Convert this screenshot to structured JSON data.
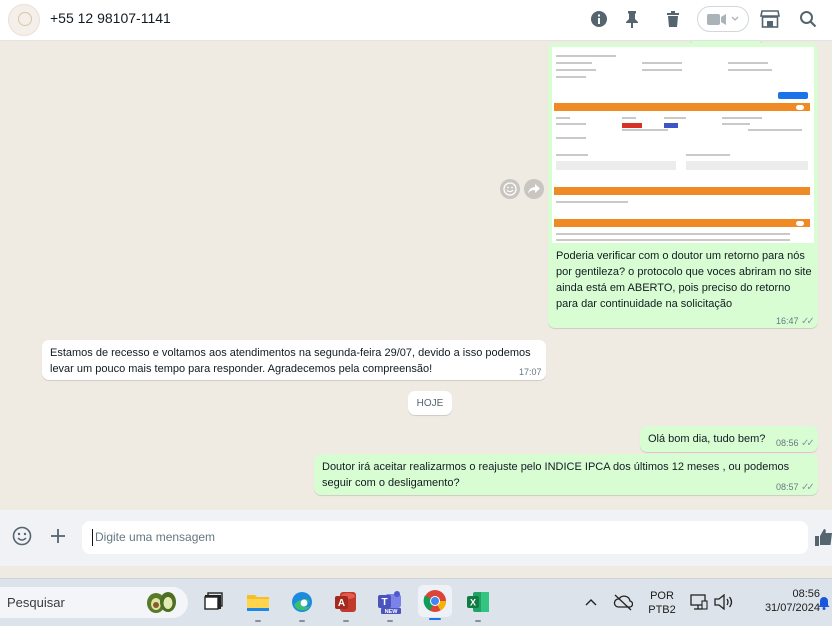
{
  "header": {
    "contact": "+55 12 98107-1141",
    "icons": [
      "info-icon",
      "pin-icon",
      "trash-icon",
      "video-icon",
      "store-icon",
      "search-icon"
    ]
  },
  "chat": {
    "screenshot_message": {
      "text": "Poderia verificar com o doutor um retorno para nós por gentileza? o protocolo que voces abriram no site ainda está em ABERTO, pois preciso do retorno para dar continuidade na solicitação",
      "time": "16:47"
    },
    "incoming": {
      "text": "Estamos de recesso e voltamos aos atendimentos na segunda-feira 29/07, devido a isso podemos levar um pouco mais tempo para responder. Agradecemos pela compreensão!",
      "time": "17:07"
    },
    "date_chip": "HOJE",
    "out1": {
      "text": "Olá bom dia, tudo bem?",
      "time": "08:56"
    },
    "out2": {
      "text": "Doutor irá aceitar realizarmos o reajuste pelo INDICE IPCA dos últimos 12 meses , ou podemos seguir com o desligamento?",
      "time": "08:57"
    }
  },
  "compose": {
    "placeholder": "Digite uma mensagem"
  },
  "taskbar": {
    "search_label": "Pesquisar",
    "lang_top": "POR",
    "lang_bottom": "PTB2",
    "clock_time": "08:56",
    "clock_date": "31/07/2024",
    "colors": {
      "accent": "#d9fdd3",
      "taskbar": "#dde3ea"
    }
  }
}
